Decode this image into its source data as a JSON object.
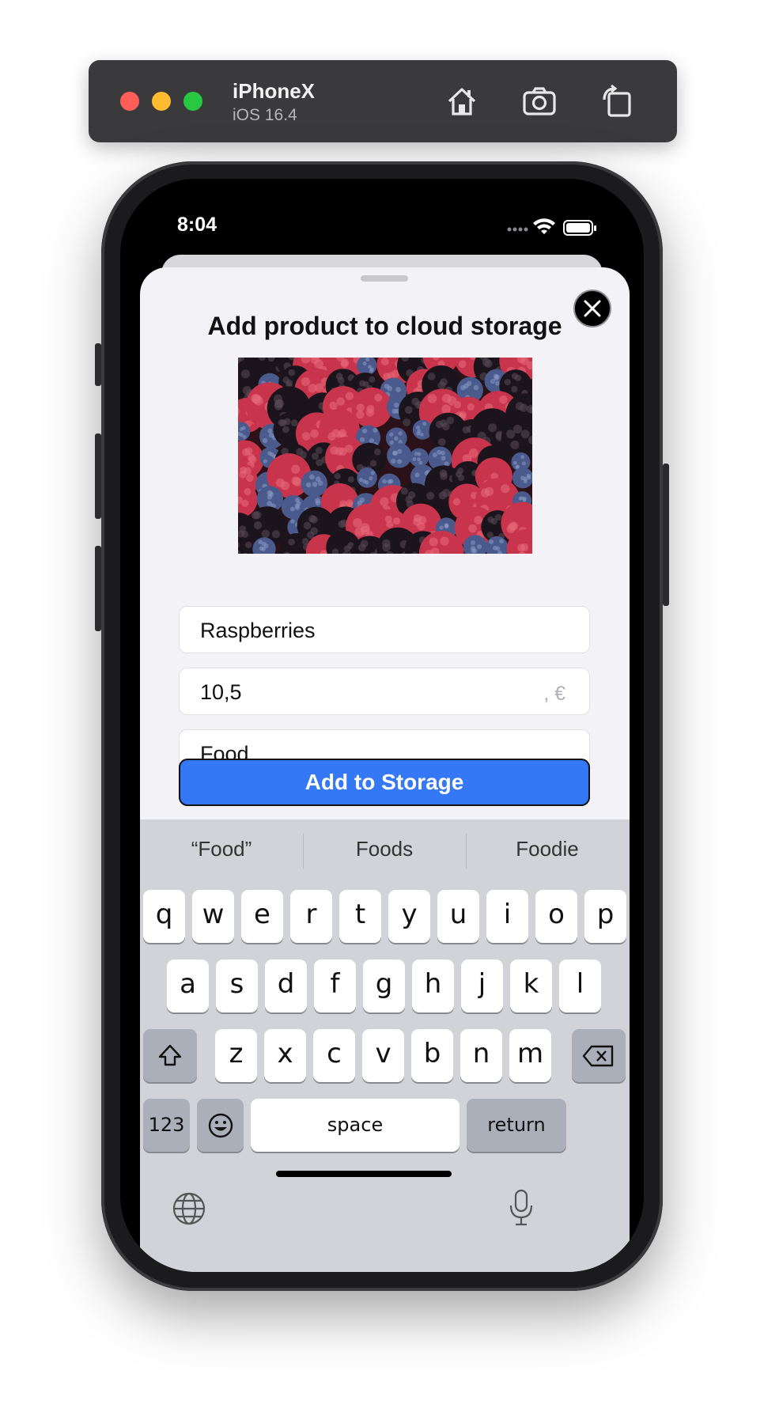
{
  "simulator": {
    "device_name": "iPhoneX",
    "os_version": "iOS 16.4",
    "buttons": [
      "home-icon",
      "screenshot-icon",
      "rotate-icon"
    ]
  },
  "status_bar": {
    "time": "8:04"
  },
  "sheet": {
    "title": "Add product to cloud storage",
    "image_subject": "berries",
    "name_value": "Raspberries",
    "price_value": "10,5",
    "price_suffix": ", €",
    "category_value": "Food",
    "submit_label": "Add to Storage"
  },
  "keyboard": {
    "suggestions": [
      "“Food”",
      "Foods",
      "Foodie"
    ],
    "row1": [
      "q",
      "w",
      "e",
      "r",
      "t",
      "y",
      "u",
      "i",
      "o",
      "p"
    ],
    "row2": [
      "a",
      "s",
      "d",
      "f",
      "g",
      "h",
      "j",
      "k",
      "l"
    ],
    "row3": [
      "z",
      "x",
      "c",
      "v",
      "b",
      "n",
      "m"
    ],
    "numbers_label": "123",
    "space_label": "space",
    "return_label": "return"
  },
  "colors": {
    "accent": "#3478f6",
    "sheet_bg": "#f2f2f7",
    "keyboard_bg": "#d1d3d9"
  }
}
